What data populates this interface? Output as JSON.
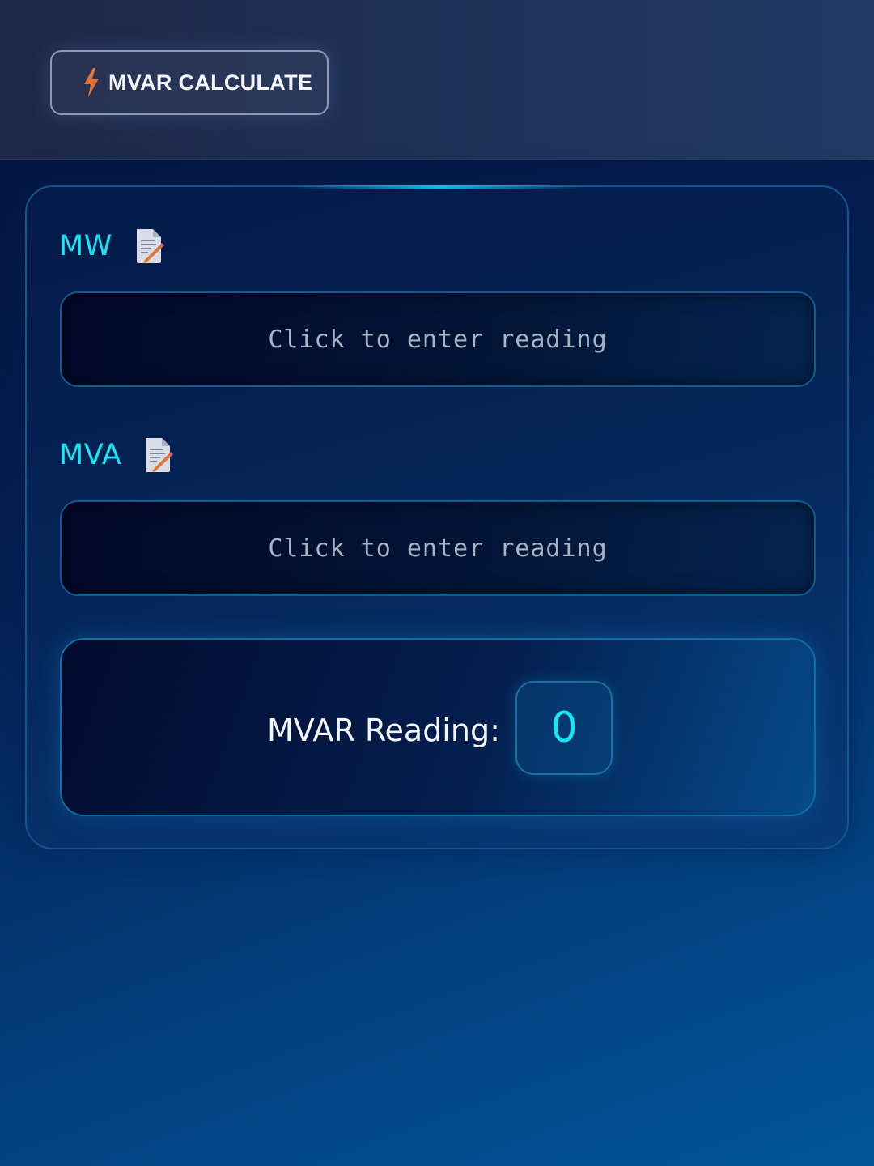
{
  "header": {
    "title_icon": "lightning-bolt-icon",
    "title": "MVAR CALCULATE"
  },
  "fields": [
    {
      "label": "MW",
      "icon": "memo-pencil-icon",
      "placeholder": "Click to enter reading"
    },
    {
      "label": "MVA",
      "icon": "memo-pencil-icon",
      "placeholder": "Click to enter reading"
    }
  ],
  "result": {
    "label": "MVAR Reading:",
    "value": "0"
  },
  "colors": {
    "accent": "#18e5f5",
    "background_start": "#04123a",
    "background_end": "#02559a",
    "icon_bolt": "#e0743a"
  }
}
